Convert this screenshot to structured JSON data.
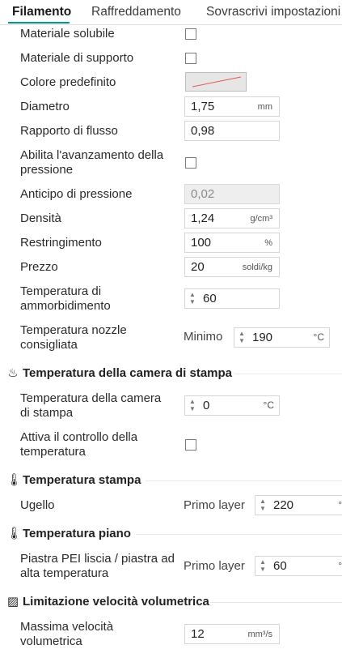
{
  "tabs": {
    "items": [
      "Filamento",
      "Raffreddamento",
      "Sovrascrivi impostazioni"
    ],
    "active": "Filamento"
  },
  "colors": {
    "accent": "#009688",
    "swatch_line": "#e05a5a"
  },
  "filament": {
    "soluble": {
      "label": "Materiale solubile",
      "checked": false
    },
    "support": {
      "label": "Materiale di supporto",
      "checked": false
    },
    "default_color": {
      "label": "Colore predefinito"
    },
    "diameter": {
      "label": "Diametro",
      "value": "1,75",
      "unit": "mm"
    },
    "flow_ratio": {
      "label": "Rapporto di flusso",
      "value": "0,98"
    },
    "pressure_advance_enable": {
      "label_line1": "Abilita l'avanzamento della",
      "label_line2": "pressione",
      "checked": false
    },
    "pressure_advance": {
      "label": "Anticipo di pressione",
      "value": "0,02"
    },
    "density": {
      "label": "Densità",
      "value": "1,24",
      "unit": "g/cm³"
    },
    "shrinkage": {
      "label": "Restringimento",
      "value": "100",
      "unit": "%"
    },
    "price": {
      "label": "Prezzo",
      "value": "20",
      "unit": "soldi/kg"
    },
    "softening_temp": {
      "label_line1": "Temperatura di",
      "label_line2": "ammorbidimento",
      "value": "60"
    },
    "nozzle_temp": {
      "label_line1": "Temperatura nozzle",
      "label_line2": "consigliata",
      "prefix": "Minimo",
      "value": "190",
      "unit": "°C"
    }
  },
  "chamber": {
    "title": "Temperatura della camera di stampa",
    "icon": "heat-waves-icon",
    "temp": {
      "label_line1": "Temperatura della camera",
      "label_line2": "di stampa",
      "value": "0",
      "unit": "°C"
    },
    "control": {
      "label_line1": "Attiva il controllo della",
      "label_line2": "temperatura",
      "checked": false
    }
  },
  "print_temp": {
    "title": "Temperatura stampa",
    "icon": "thermometer-icon",
    "nozzle": {
      "label": "Ugello",
      "prefix": "Primo layer",
      "value": "220",
      "unit": "°"
    }
  },
  "bed_temp": {
    "title": "Temperatura piano",
    "icon": "thermometer-icon",
    "pei": {
      "label_line1": "Piastra PEI liscia / piastra ad",
      "label_line2": "alta temperatura",
      "prefix": "Primo layer",
      "value": "60",
      "unit": "°"
    }
  },
  "volumetric": {
    "title": "Limitazione velocità volumetrica",
    "icon": "speed-limit-icon",
    "max_speed": {
      "label_line1": "Massima velocità",
      "label_line2": "volumetrica",
      "value": "12",
      "unit": "mm³/s"
    }
  }
}
